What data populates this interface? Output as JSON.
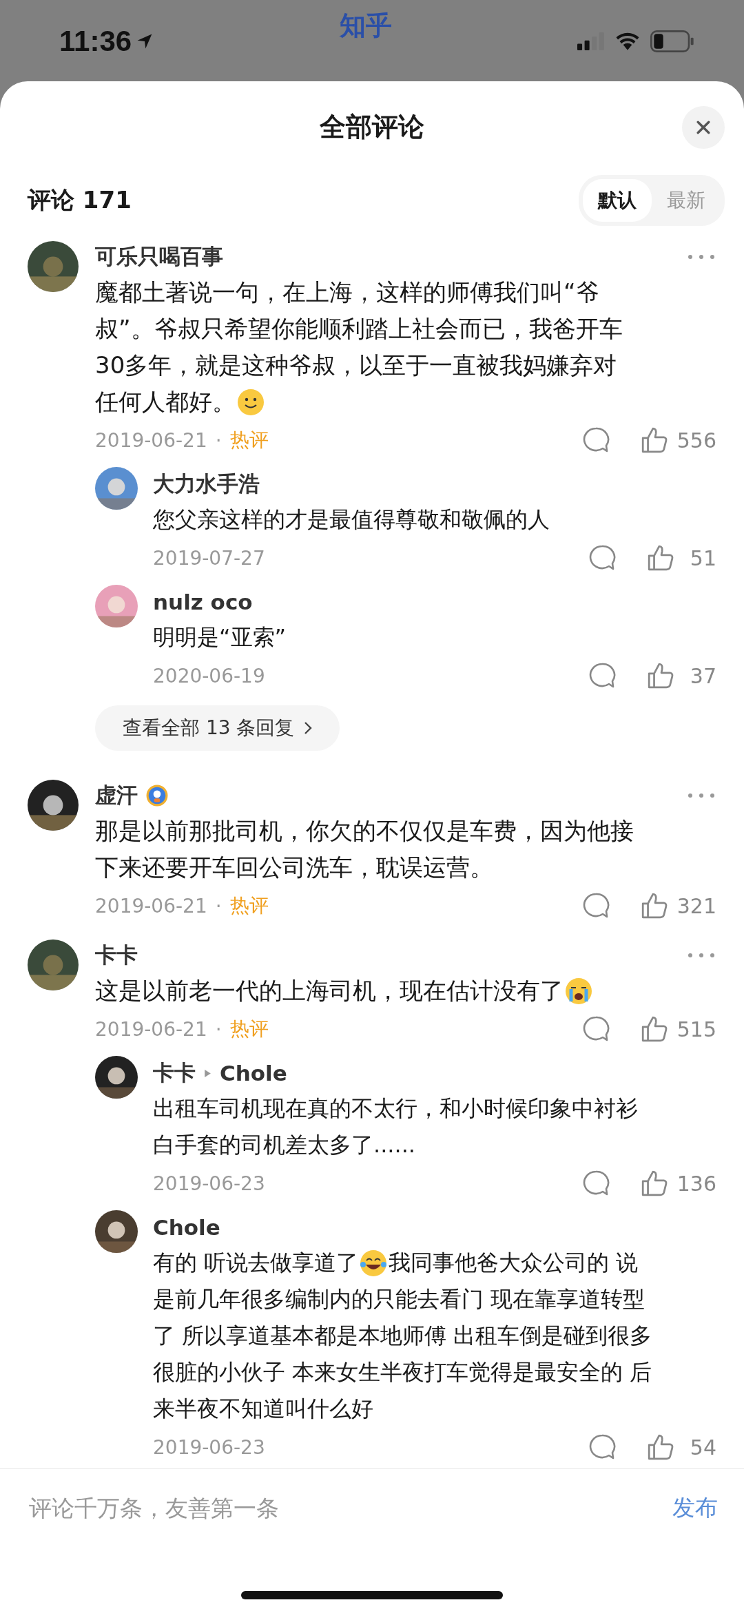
{
  "status_bar": {
    "time": "11:36",
    "app_label": "知乎"
  },
  "header": {
    "title": "全部评论"
  },
  "comments_header": {
    "count_label": "评论 171",
    "sort_tabs": [
      {
        "label": "默认",
        "selected": true
      },
      {
        "label": "最新",
        "selected": false
      }
    ]
  },
  "comments": [
    {
      "author": "可乐只喝百事",
      "lines": [
        [
          {
            "kind": "text",
            "text": "魔都土著说一句，在上海，这样的师傅我们叫“爷"
          }
        ],
        [
          {
            "kind": "text",
            "text": "叔”。爷叔只希望你能顺利踏上社会而已，我爸开车"
          }
        ],
        [
          {
            "kind": "text",
            "text": "30多年，就是这种爷叔，以至于一直被我妈嫌弃对"
          }
        ],
        [
          {
            "kind": "text",
            "text": "任何人都好。"
          },
          {
            "kind": "smile_emoji"
          }
        ]
      ],
      "date": "2019-06-21",
      "separator": "·",
      "tag": "热评",
      "likes": "556",
      "replies": [
        {
          "author": "大力水手浩",
          "lines": [
            [
              {
                "kind": "text",
                "text": "您父亲这样的才是最值得尊敬和敬佩的人"
              }
            ]
          ],
          "date": "2019-07-27",
          "likes": "51"
        },
        {
          "author": "nulz oco",
          "lines": [
            [
              {
                "kind": "text",
                "text": "明明是“亚索”"
              }
            ]
          ],
          "date": "2020-06-19",
          "likes": "37"
        }
      ],
      "more_replies": "查看全部 13 条回复"
    },
    {
      "author": "虚汗",
      "badge": true,
      "lines": [
        [
          {
            "kind": "text",
            "text": "那是以前那批司机，你欠的不仅仅是车费，因为他接"
          }
        ],
        [
          {
            "kind": "text",
            "text": "下来还要开车回公司洗车，耽误运营。"
          }
        ]
      ],
      "date": "2019-06-21",
      "separator": "·",
      "tag": "热评",
      "likes": "321"
    },
    {
      "author": "卡卡",
      "lines": [
        [
          {
            "kind": "text",
            "text": "这是以前老一代的上海司机，现在估计没有了"
          },
          {
            "kind": "crying_emoji"
          }
        ]
      ],
      "date": "2019-06-21",
      "separator": "·",
      "tag": "热评",
      "likes": "515",
      "replies": [
        {
          "author": "卡卡",
          "reply_to": "Chole",
          "lines": [
            [
              {
                "kind": "text",
                "text": "出租车司机现在真的不太行，和小时候印象中衬衫"
              }
            ],
            [
              {
                "kind": "text",
                "text": "白手套的司机差太多了......"
              }
            ]
          ],
          "date": "2019-06-23",
          "likes": "136"
        },
        {
          "author": "Chole",
          "lines": [
            [
              {
                "kind": "text",
                "text": "有的 听说去做享道了"
              },
              {
                "kind": "laughing_emoji"
              },
              {
                "kind": "text",
                "text": "我同事他爸大众公司的 说"
              }
            ],
            [
              {
                "kind": "text",
                "text": "是前几年很多编制内的只能去看门 现在靠享道转型"
              }
            ],
            [
              {
                "kind": "text",
                "text": "了 所以享道基本都是本地师傅 出租车倒是碰到很多"
              }
            ],
            [
              {
                "kind": "text",
                "text": "很脏的小伙子 本来女生半夜打车觉得是最安全的 后"
              }
            ],
            [
              {
                "kind": "text",
                "text": "来半夜不知道叫什么好"
              }
            ]
          ],
          "date": "2019-06-23",
          "likes": "54"
        }
      ]
    }
  ],
  "composer": {
    "placeholder": "评论千万条，友善第一条",
    "submit": "发布"
  }
}
